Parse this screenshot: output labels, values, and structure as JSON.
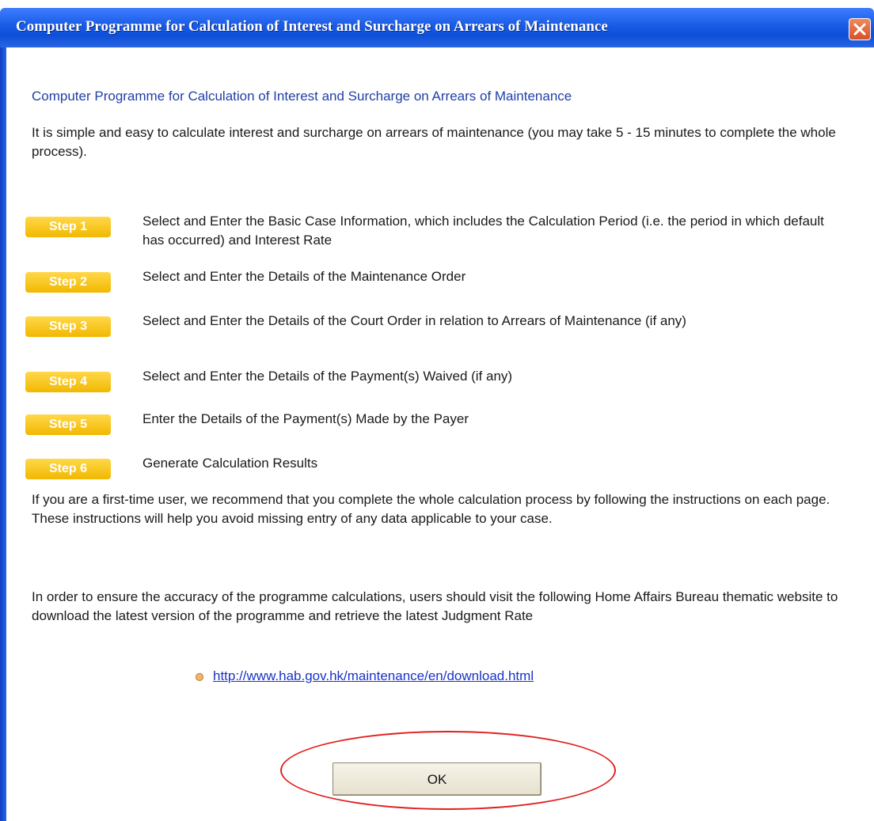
{
  "window": {
    "title": "Computer Programme for Calculation of Interest and Surcharge on Arrears of Maintenance"
  },
  "content": {
    "heading": "Computer Programme for Calculation of Interest and Surcharge on Arrears of Maintenance",
    "intro": "It is simple and easy to calculate interest and surcharge on arrears of maintenance (you may take 5 - 15 minutes to complete the whole process).",
    "steps": [
      {
        "badge": "Step 1",
        "text": "Select and Enter the Basic Case Information, which includes the Calculation Period (i.e. the period in which default has occurred) and Interest Rate"
      },
      {
        "badge": "Step 2",
        "text": "Select and Enter the Details of the Maintenance Order"
      },
      {
        "badge": "Step 3",
        "text": "Select and Enter the Details of the Court Order in relation to Arrears of Maintenance (if any)"
      },
      {
        "badge": "Step 4",
        "text": "Select and Enter the Details of the Payment(s) Waived (if any)"
      },
      {
        "badge": "Step 5",
        "text": "Enter the Details of the Payment(s) Made by the Payer"
      },
      {
        "badge": "Step 6",
        "text": "Generate Calculation Results"
      }
    ],
    "first_time": "If you are a first-time user, we recommend that you complete the whole calculation process by following the instructions on each page. These instructions will help you avoid missing entry of any data applicable to your case.",
    "accuracy": "In order to ensure the accuracy of the programme calculations, users should visit the following Home Affairs Bureau thematic website to download the latest version of the programme and retrieve the latest Judgment Rate",
    "link": "http://www.hab.gov.hk/maintenance/en/download.html"
  },
  "buttons": {
    "ok": "OK"
  },
  "icons": {
    "close": "close-icon",
    "bullet": "bullet-icon"
  },
  "colors": {
    "titlebar": "#1a5be6",
    "badge": "#f1b800",
    "heading": "#1f3fa8",
    "link": "#1a33c9",
    "highlight_ring": "#e02020"
  }
}
